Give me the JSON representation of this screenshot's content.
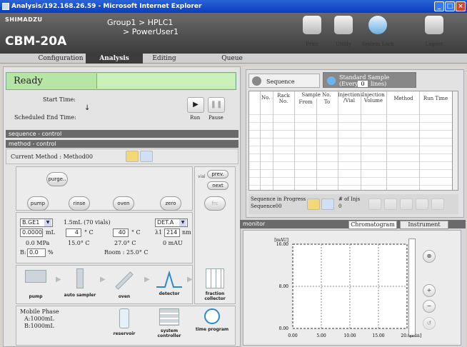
{
  "window": {
    "title": "Analysis/192.168.26.59 - Microsoft Internet Explorer",
    "minimize": "_",
    "maximize": "□",
    "close": "×"
  },
  "header": {
    "brand": "SHIMADZU",
    "model": "CBM-20A",
    "group_line": "Group1  >  HPLC1",
    "user_line": "> PowerUser1"
  },
  "toolbar": {
    "print": "Print",
    "utility": "Utility",
    "system_lock": "System Lock",
    "logout": "Logout"
  },
  "tabs": [
    "Configuration",
    "Analysis",
    "Editing",
    "Queue"
  ],
  "status": {
    "state": "Ready",
    "start_time_label": "Start Time:",
    "end_time_label": "Scheduled End Time:",
    "arrow": "↓",
    "run": "Run",
    "pause": "Pause"
  },
  "sections": {
    "sequence_control": "sequence - control",
    "method_control": "method - control",
    "current_method": "Current Method : Method00"
  },
  "buttons": {
    "purge": "purge..",
    "pump": "pump",
    "rinse": "rinse",
    "oven": "oven",
    "zero": "zero",
    "frc": "frc",
    "prev": "prev.",
    "next": "next",
    "vial": "vial"
  },
  "pump": {
    "channel": "B.GE1",
    "flow": "0.0000",
    "flow_unit": "mL",
    "pressure": "0.0 MPa",
    "b_label": "B:",
    "b_conc": "0.0",
    "b_unit": "%"
  },
  "sampler": {
    "vials": "1.5mL (70 vials)",
    "temp": "4",
    "temp_unit": "° C",
    "actual": "15.0° C"
  },
  "oven": {
    "temp": "40",
    "temp_unit": "° C",
    "actual": "27.0° C",
    "room": "Room : 25.0° C"
  },
  "detector": {
    "channel": "DET.A",
    "wl_label": "λ1",
    "wavelength": "214",
    "wl_unit": "nm",
    "signal": "0 mAU"
  },
  "devices": [
    "pump",
    "auto sampler",
    "oven",
    "detector",
    "fraction collector"
  ],
  "mobile_phase": {
    "title": "Mobile Phase",
    "a": "A:1000mL",
    "b": "B:1000mL"
  },
  "bottom_devices": [
    "reservoir",
    "system controller",
    "time program"
  ],
  "sequence": {
    "tab": "Sequence",
    "standard_title": "Standard Sample",
    "standard_every": "(Every",
    "standard_count": "0",
    "standard_lines": "lines)",
    "headers": [
      "No.",
      "Rack No.",
      "Sample No.",
      "From",
      "To",
      "Injections /Vial",
      "Injection Volume",
      "Method",
      "Run Time"
    ],
    "progress": "Sequence in Progress",
    "progress_name": "Sequence00",
    "injs_label": "# of Injs",
    "injs": "0"
  },
  "monitor": {
    "title": "monitor",
    "tab_chromatogram": "Chromatogram",
    "tab_instrument": "Instrument"
  },
  "chart_data": {
    "type": "line",
    "ylabel": "[mAU]",
    "xlabel": "[min]",
    "xticks": [
      "0.00",
      "5.00",
      "10.00",
      "15.00",
      "20.00"
    ],
    "yticks": [
      "16.00",
      "8.00",
      "0.00"
    ],
    "xlim": [
      0,
      20
    ],
    "ylim": [
      0,
      16
    ],
    "series": []
  }
}
